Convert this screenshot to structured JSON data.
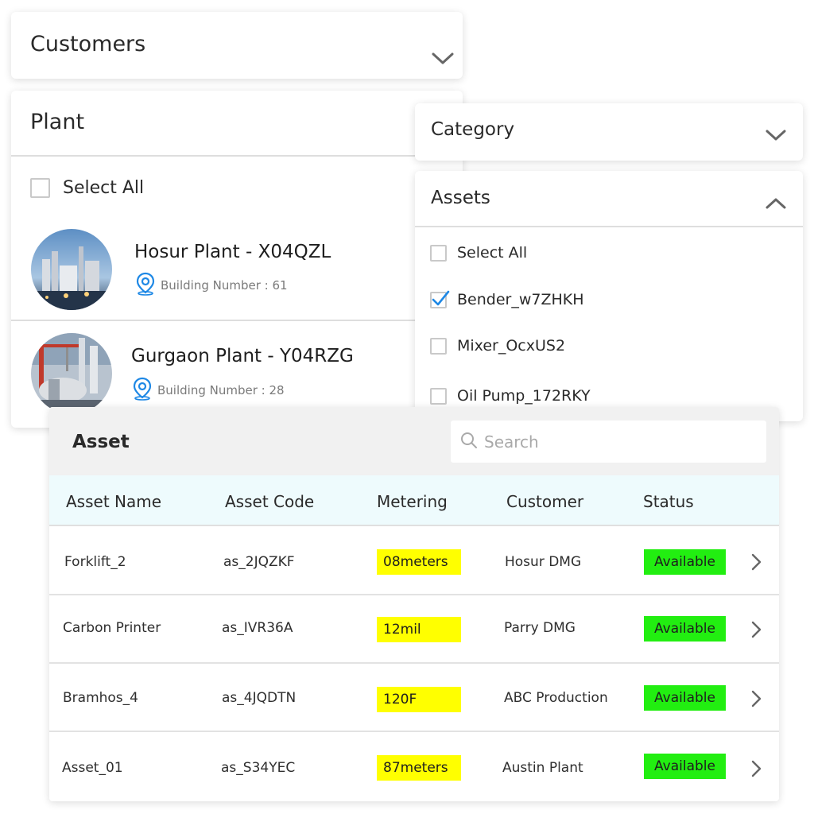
{
  "customers": {
    "title": "Customers"
  },
  "plant": {
    "title": "Plant",
    "select_all_label": "Select All",
    "plants": [
      {
        "name": "Hosur Plant - X04QZL",
        "building": "Building Number : 61"
      },
      {
        "name": "Gurgaon Plant - Y04RZG",
        "building": "Building Number : 28"
      }
    ]
  },
  "category": {
    "title": "Category"
  },
  "assets_dropdown": {
    "title": "Assets",
    "options": [
      {
        "label": "Select All",
        "checked": false
      },
      {
        "label": "Bender_w7ZHKH",
        "checked": true
      },
      {
        "label": "Mixer_OcxUS2",
        "checked": false
      },
      {
        "label": "Oil Pump_172RKY",
        "checked": false
      }
    ]
  },
  "asset_table": {
    "title": "Asset",
    "search_placeholder": "Search",
    "columns": [
      "Asset Name",
      "Asset Code",
      "Metering",
      "Customer",
      "Status"
    ],
    "rows": [
      {
        "name": "Forklift_2",
        "code": "as_2JQZKF",
        "metering": "08meters",
        "customer": "Hosur DMG",
        "status": "Available"
      },
      {
        "name": "Carbon Printer",
        "code": "as_IVR36A",
        "metering": "12mil",
        "customer": "Parry DMG",
        "status": "Available"
      },
      {
        "name": "Bramhos_4",
        "code": "as_4JQDTN",
        "metering": "120F",
        "customer": "ABC Production",
        "status": "Available"
      },
      {
        "name": "Asset_01",
        "code": "as_S34YEC",
        "metering": "87meters",
        "customer": "Austin Plant",
        "status": "Available"
      }
    ]
  },
  "colors": {
    "metering_highlight": "#ffff00",
    "status_available": "#22ee11",
    "check_accent": "#1e88e5",
    "table_header_bg": "#eefbfd"
  },
  "icons": {
    "dropdown": "chevron-down-icon",
    "collapse": "chevron-up-icon",
    "location": "location-pin-icon",
    "search": "search-icon",
    "row_action": "chevron-right-icon",
    "check": "checkmark-icon"
  }
}
